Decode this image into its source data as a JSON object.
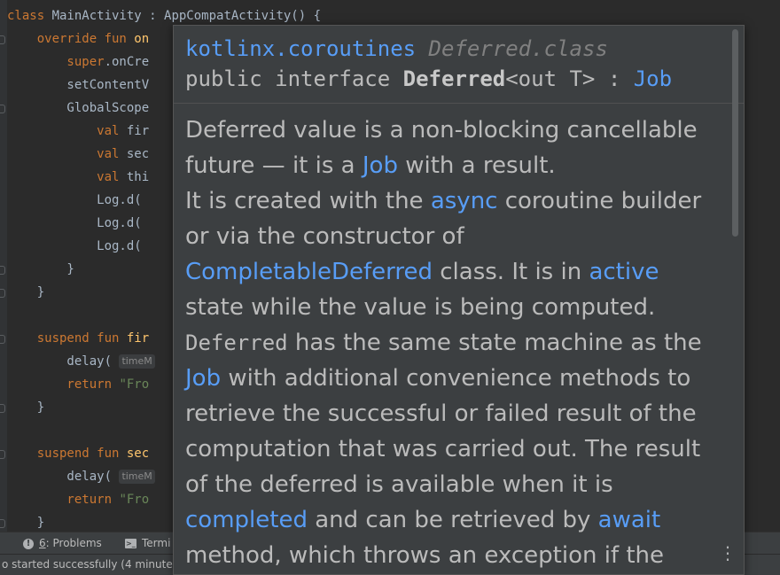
{
  "editor": {
    "lines": [
      [
        {
          "t": "class ",
          "c": "kw"
        },
        {
          "t": "MainActivity : AppCompatActivity() {",
          "c": "plain"
        }
      ],
      [
        {
          "t": "    override fun ",
          "c": "kw"
        },
        {
          "t": "on",
          "c": "fn"
        }
      ],
      [
        {
          "t": "        super",
          "c": "kw"
        },
        {
          "t": ".onCre",
          "c": "plain"
        }
      ],
      [
        {
          "t": "        setContentV",
          "c": "plain"
        }
      ],
      [
        {
          "t": "        GlobalScope",
          "c": "plain"
        }
      ],
      [
        {
          "t": "            val ",
          "c": "kw"
        },
        {
          "t": "fir",
          "c": "plain"
        }
      ],
      [
        {
          "t": "            val ",
          "c": "kw"
        },
        {
          "t": "sec",
          "c": "plain"
        }
      ],
      [
        {
          "t": "            val ",
          "c": "kw"
        },
        {
          "t": "thi",
          "c": "plain"
        }
      ],
      [
        {
          "t": "            Log.d(",
          "c": "plain"
        }
      ],
      [
        {
          "t": "            Log.d(",
          "c": "plain"
        }
      ],
      [
        {
          "t": "            Log.d(",
          "c": "plain"
        }
      ],
      [
        {
          "t": "        }",
          "c": "plain"
        }
      ],
      [
        {
          "t": "    }",
          "c": "plain"
        }
      ],
      [],
      [
        {
          "t": "    suspend fun ",
          "c": "kw"
        },
        {
          "t": "fir",
          "c": "fn"
        }
      ],
      [
        {
          "t": "        delay( ",
          "c": "plain"
        },
        {
          "t": "timeM",
          "c": "hint"
        }
      ],
      [
        {
          "t": "        return ",
          "c": "kw"
        },
        {
          "t": "\"Fro",
          "c": "str"
        }
      ],
      [
        {
          "t": "    }",
          "c": "plain"
        }
      ],
      [],
      [
        {
          "t": "    suspend fun ",
          "c": "kw"
        },
        {
          "t": "sec",
          "c": "fn"
        }
      ],
      [
        {
          "t": "        delay( ",
          "c": "plain"
        },
        {
          "t": "timeM",
          "c": "hint"
        }
      ],
      [
        {
          "t": "        return ",
          "c": "kw"
        },
        {
          "t": "\"Fro",
          "c": "str"
        }
      ],
      [
        {
          "t": "    }",
          "c": "plain"
        }
      ]
    ]
  },
  "toolwindows": {
    "problems_icon_glyph": "!",
    "problems_number": "6",
    "problems_label": ": Problems",
    "terminal_icon_glyph": ">_",
    "terminal_label": "Termi"
  },
  "status": {
    "text": "o started successfully (4 minute"
  },
  "popup": {
    "package": "kotlinx.coroutines",
    "class_file": "Deferred.class",
    "sig_public_interface": "public interface ",
    "sig_name": "Deferred",
    "sig_generic": "<out T> : ",
    "sig_supertype": "Job",
    "more_icon_glyph": "⋮",
    "body": {
      "p1_a": "Deferred value is a non-blocking cancellable future — it is a ",
      "p1_link_job": "Job",
      "p1_b": " with a result.",
      "p2_a": "It is created with the ",
      "p2_link_async": "async",
      "p2_b": " coroutine builder or via the constructor of ",
      "p2_link_completable": "CompletableDeferred",
      "p2_c": " class. It is in ",
      "p2_link_active": "active",
      "p2_d": " state while the value is being computed.",
      "p3_code": "Deferred",
      "p3_a": " has the same state machine as the ",
      "p3_link_job": "Job",
      "p3_b": " with additional convenience methods to retrieve the successful or failed result of the computation that was carried out. The result of the deferred is available when it is ",
      "p3_link_completed": "completed",
      "p3_c": " and can be retrieved by ",
      "p3_link_await": "await",
      "p3_d": " method, which throws an exception if the"
    }
  }
}
